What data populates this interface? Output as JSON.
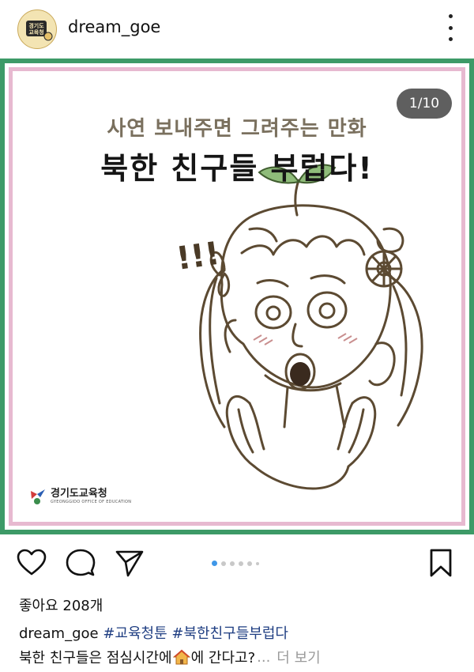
{
  "header": {
    "avatar_text": "경기도교육청",
    "username": "dream_goe"
  },
  "post": {
    "counter": "1/10",
    "subtitle": "사연 보내주면 그려주는 만화",
    "title": "북한 친구들 부럽다!",
    "exclaim": "!!!",
    "logo_korean": "경기도교육청",
    "logo_english": "GYEONGGIDO OFFICE OF EDUCATION",
    "colors": {
      "outer_border": "#3d9a67",
      "inner_border": "#e7b9d0",
      "line_art": "#5c4a32",
      "carousel_active": "#3f97e8"
    }
  },
  "actions": {
    "icons": [
      "heart-icon",
      "comment-icon",
      "share-icon",
      "bookmark-icon"
    ],
    "carousel": {
      "active": 1,
      "visible_dots": 6
    }
  },
  "likes_text": "좋아요 208개",
  "caption": {
    "username": "dream_goe",
    "hashtags": "#교육청툰 #북한친구들부럽다",
    "line2_before": "북한 친구들은 점심시간에",
    "line2_after": "에 간다고?",
    "ellipsis": "...",
    "more_label": "더 보기"
  }
}
